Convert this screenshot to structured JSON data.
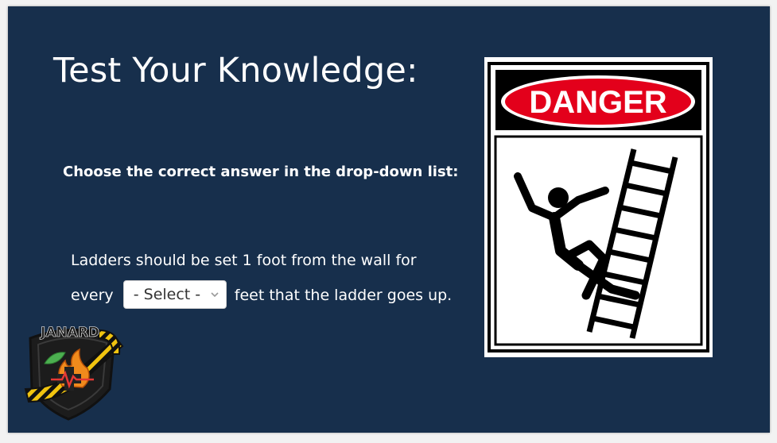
{
  "slide": {
    "title": "Test Your Knowledge:",
    "instruction": "Choose the correct answer in the drop-down list:",
    "question": {
      "line1": "Ladders should be set 1 foot from the wall for",
      "line2_prefix": "every",
      "line2_suffix": "feet that the ladder goes up."
    },
    "dropdown": {
      "selected": "- Select -"
    },
    "sign": {
      "header_text": "DANGER",
      "header_color": "#e3001b",
      "icon": "falling-person-ladder-icon"
    },
    "logo": {
      "name": "janard-logo",
      "text": "JANARD"
    },
    "colors": {
      "background": "#172f4c",
      "text": "#ffffff"
    }
  }
}
